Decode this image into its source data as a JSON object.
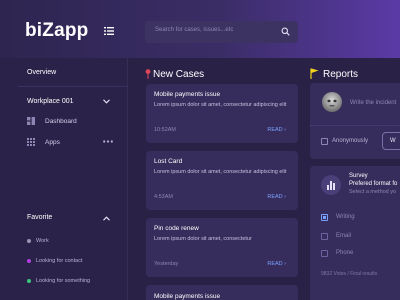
{
  "app": {
    "logo": "biZapp"
  },
  "search": {
    "placeholder": "Search for cases, issues...etc"
  },
  "sidebar": {
    "overview": "Overview",
    "workplace": "Workplace 001",
    "items": [
      {
        "label": "Dashboard",
        "icon": "dashboard-icon"
      },
      {
        "label": "Apps",
        "icon": "apps-grid-icon"
      }
    ],
    "favorite_title": "Favorite",
    "favorites": [
      {
        "label": "Work",
        "color": "#9a94b3"
      },
      {
        "label": "Looking for contact",
        "color": "#b13fe0"
      },
      {
        "label": "Looking for something",
        "color": "#38c77a"
      }
    ]
  },
  "new_cases": {
    "title": "New Cases",
    "cards": [
      {
        "title": "Mobile payments issue",
        "body": "Lorem ipsum dolor sit amet, consectetur adipiscing elit",
        "time": "10:52AM",
        "action": "READ ›"
      },
      {
        "title": "Lost Card",
        "body": "Lorem ipsum dolor sit amet, consectetur adipiscing elit",
        "time": "4:53AM",
        "action": "READ ›"
      },
      {
        "title": "Pin code renew",
        "body": "Lorem ipsum dolor sit amet, consectetur",
        "time": "Yesterday",
        "action": "READ ›"
      },
      {
        "title": "Mobile payments issue"
      }
    ]
  },
  "reports": {
    "title": "Reports",
    "placeholder": "Write the incident",
    "anonymous": "Anonymously",
    "button": "W"
  },
  "survey": {
    "title": "Survey",
    "question": "Prefered format fo",
    "hint": "Select a method yo",
    "options": [
      {
        "label": "Writing",
        "checked": true
      },
      {
        "label": "Email",
        "checked": false
      },
      {
        "label": "Phone",
        "checked": false
      }
    ],
    "votes": "9832 Votes / Final results"
  },
  "colors": {
    "accent": "#7aa1ff",
    "flag": "#f2d21b",
    "pin": "#e0455a"
  }
}
